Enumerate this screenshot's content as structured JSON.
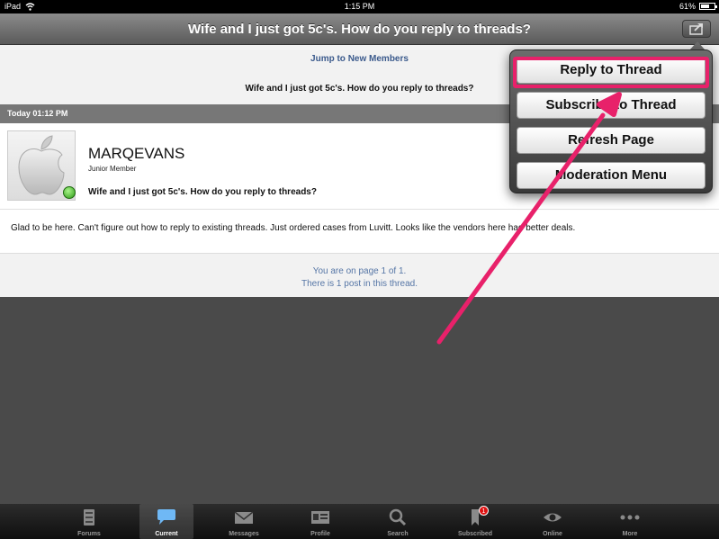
{
  "status": {
    "carrier": "iPad",
    "time": "1:15 PM",
    "battery": "61%",
    "battery_level": 0.61
  },
  "nav": {
    "title": "Wife and I just got 5c's.  How do you reply to threads?",
    "action_icon": "share-icon"
  },
  "thread": {
    "jump_link": "Jump to New Members",
    "title": "Wife and I just got 5c's.  How do you reply to threads?",
    "date": "Today 01:12 PM"
  },
  "post": {
    "username": "MARQEVANS",
    "user_title": "Junior Member",
    "title": "Wife and I just got 5c's.  How do you reply to threads?",
    "body": "Glad to be here. Can't figure out how to reply to existing threads.  Just ordered cases from Luvitt. Looks like the vendors here had better deals."
  },
  "pagination": {
    "line1": "You are on page 1 of 1.",
    "line2": "There is 1 post in this thread."
  },
  "menu": {
    "items": [
      {
        "label": "Reply to Thread"
      },
      {
        "label": "Subscribe to Thread"
      },
      {
        "label": "Refresh Page"
      },
      {
        "label": "Moderation Menu"
      }
    ]
  },
  "annotation_color": "#e8216a",
  "tabs": [
    {
      "label": "Forums",
      "icon": "forums-icon"
    },
    {
      "label": "Current",
      "icon": "current-icon",
      "active": true
    },
    {
      "label": "Messages",
      "icon": "messages-icon"
    },
    {
      "label": "Profile",
      "icon": "profile-icon"
    },
    {
      "label": "Search",
      "icon": "search-icon"
    },
    {
      "label": "Subscribed",
      "icon": "subscribed-icon",
      "badge": "1"
    },
    {
      "label": "Online",
      "icon": "online-icon"
    },
    {
      "label": "More",
      "icon": "more-icon"
    }
  ]
}
